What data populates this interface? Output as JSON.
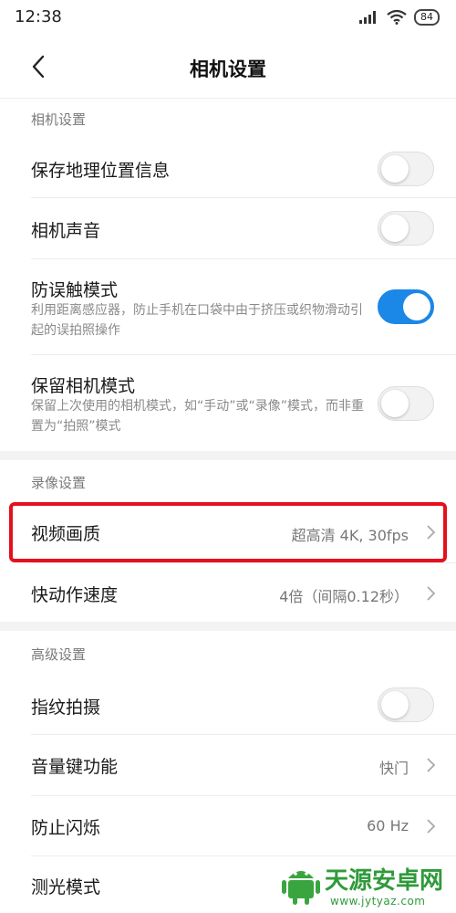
{
  "status_bar": {
    "time": "12:38",
    "battery": "84"
  },
  "header": {
    "title": "相机设置"
  },
  "sections": {
    "camera": {
      "title": "相机设置",
      "items": [
        {
          "title": "保存地理位置信息",
          "toggle": false
        },
        {
          "title": "相机声音",
          "toggle": false
        },
        {
          "title": "防误触模式",
          "desc": "利用距离感应器，防止手机在口袋中由于挤压或织物滑动引起的误拍照操作",
          "toggle": true
        },
        {
          "title": "保留相机模式",
          "desc": "保留上次使用的相机模式，如“手动”或“录像”模式，而非重置为“拍照”模式",
          "toggle": false
        }
      ]
    },
    "video": {
      "title": "录像设置",
      "items": [
        {
          "title": "视频画质",
          "value": "超高清 4K, 30fps"
        },
        {
          "title": "快动作速度",
          "value": "4倍（间隔0.12秒）"
        }
      ]
    },
    "advanced": {
      "title": "高级设置",
      "items": [
        {
          "title": "指纹拍摄",
          "toggle": false
        },
        {
          "title": "音量键功能",
          "value": "快门"
        },
        {
          "title": "防止闪烁",
          "value": "60 Hz"
        },
        {
          "title": "测光模式"
        }
      ]
    }
  },
  "watermark": {
    "name": "天源安卓网",
    "url": "www.jytyaz.com"
  },
  "colors": {
    "accent": "#1b87e6",
    "highlight": "#e5101d",
    "watermark": "#2f9a3a"
  }
}
